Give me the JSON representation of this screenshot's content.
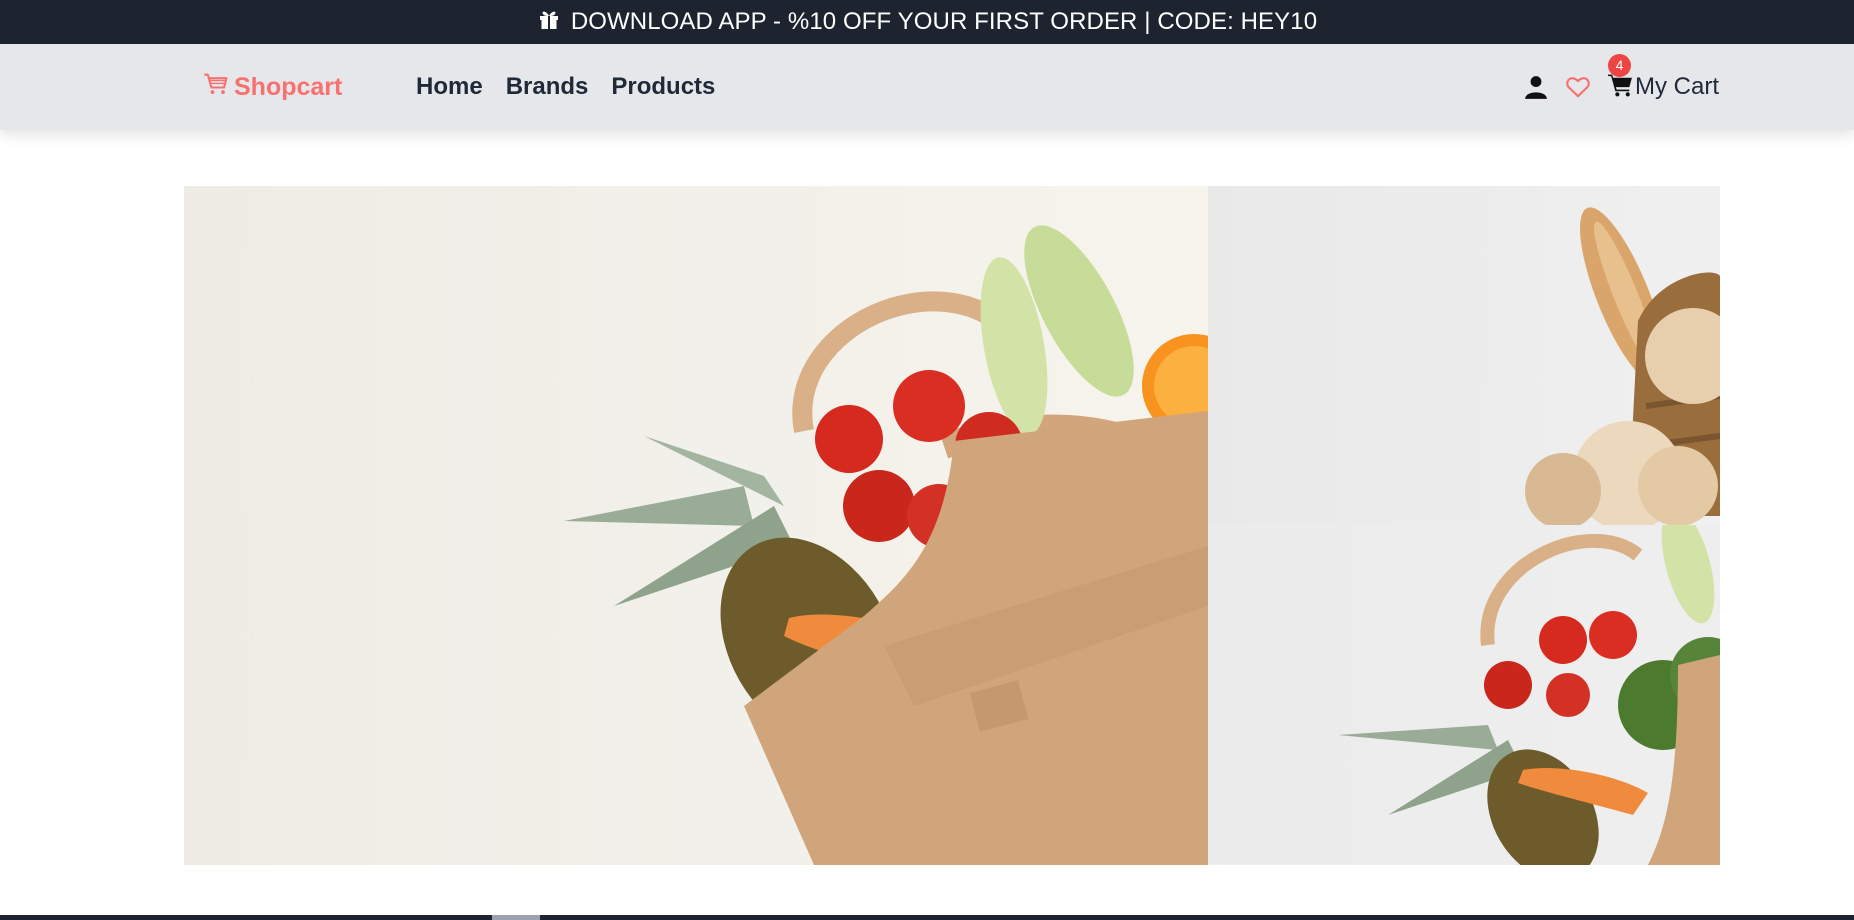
{
  "announcement": {
    "icon": "gift-icon",
    "text": "DOWNLOAD APP - %10 OFF YOUR FIRST ORDER | CODE: HEY10"
  },
  "navbar": {
    "logo": {
      "icon": "cart-icon",
      "text": "Shopcart",
      "color": "#f87171"
    },
    "links": [
      {
        "label": "Home"
      },
      {
        "label": "Brands"
      },
      {
        "label": "Products"
      }
    ],
    "actions": {
      "account_icon": "user-icon",
      "wishlist_icon": "heart-icon",
      "cart": {
        "icon": "shopping-cart-icon",
        "label": "My Cart",
        "count": "4"
      }
    }
  },
  "hero": {
    "slides": [
      {
        "name": "grocery-bag-vegetables"
      },
      {
        "name": "bread-basket"
      },
      {
        "name": "grocery-bag-vegetables-small"
      }
    ]
  },
  "colors": {
    "topbar_bg": "#1d232f",
    "navbar_bg": "#e5e7eb",
    "accent": "#f87171",
    "badge": "#ef4444"
  }
}
